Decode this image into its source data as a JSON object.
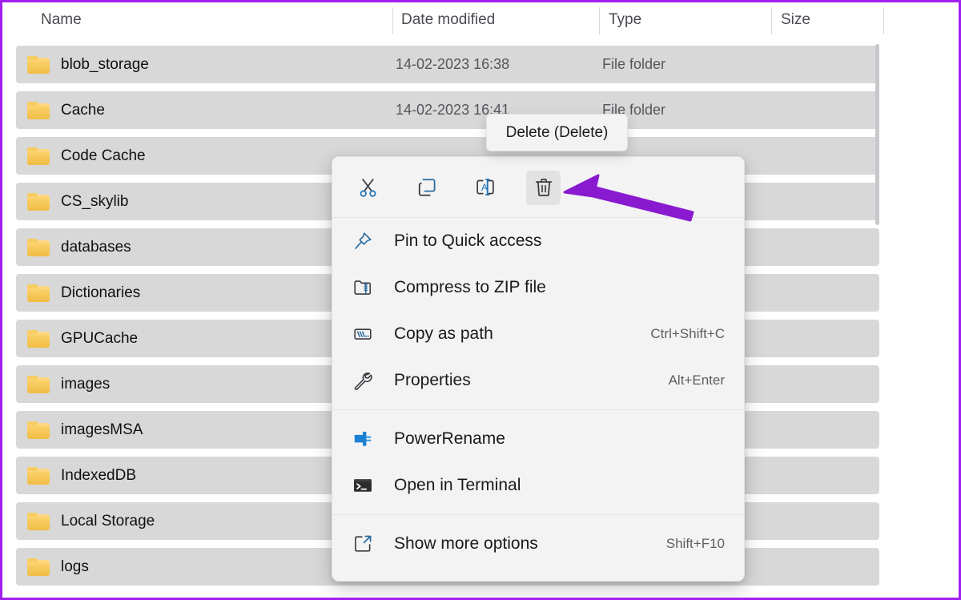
{
  "window": {
    "accent_border_color": "#a020f0",
    "row_bg_color": "#d8d8d8",
    "menu_bg_color": "#f3f3f3",
    "annotation_arrow_color": "#8a1ad0"
  },
  "columns": [
    {
      "label": "Name",
      "key": "name"
    },
    {
      "label": "Date modified",
      "key": "date"
    },
    {
      "label": "Type",
      "key": "type"
    },
    {
      "label": "Size",
      "key": "size"
    }
  ],
  "files": [
    {
      "name": "blob_storage",
      "date": "14-02-2023 16:38",
      "type": "File folder",
      "size": ""
    },
    {
      "name": "Cache",
      "date": "14-02-2023 16:41",
      "type": "File folder",
      "size": ""
    },
    {
      "name": "Code Cache",
      "date": "",
      "type": "",
      "size": ""
    },
    {
      "name": "CS_skylib",
      "date": "",
      "type": "",
      "size": ""
    },
    {
      "name": "databases",
      "date": "",
      "type": "",
      "size": ""
    },
    {
      "name": "Dictionaries",
      "date": "",
      "type": "",
      "size": ""
    },
    {
      "name": "GPUCache",
      "date": "",
      "type": "",
      "size": ""
    },
    {
      "name": "images",
      "date": "",
      "type": "",
      "size": ""
    },
    {
      "name": "imagesMSA",
      "date": "",
      "type": "",
      "size": ""
    },
    {
      "name": "IndexedDB",
      "date": "",
      "type": "",
      "size": ""
    },
    {
      "name": "Local Storage",
      "date": "",
      "type": "",
      "size": ""
    },
    {
      "name": "logs",
      "date": "",
      "type": "",
      "size": ""
    }
  ],
  "tooltip": {
    "text": "Delete (Delete)"
  },
  "context_menu": {
    "toolbar": [
      {
        "icon": "cut-icon",
        "label": "Cut",
        "hovered": false
      },
      {
        "icon": "copy-icon",
        "label": "Copy",
        "hovered": false
      },
      {
        "icon": "rename-icon",
        "label": "Rename",
        "hovered": false
      },
      {
        "icon": "delete-icon",
        "label": "Delete",
        "hovered": true
      }
    ],
    "groups": [
      {
        "items": [
          {
            "icon": "pin-icon",
            "label": "Pin to Quick access",
            "accel": ""
          },
          {
            "icon": "zip-icon",
            "label": "Compress to ZIP file",
            "accel": ""
          },
          {
            "icon": "path-icon",
            "label": "Copy as path",
            "accel": "Ctrl+Shift+C"
          },
          {
            "icon": "wrench-icon",
            "label": "Properties",
            "accel": "Alt+Enter"
          }
        ]
      },
      {
        "items": [
          {
            "icon": "powerrename-icon",
            "label": "PowerRename",
            "accel": ""
          },
          {
            "icon": "terminal-icon",
            "label": "Open in Terminal",
            "accel": ""
          }
        ]
      },
      {
        "items": [
          {
            "icon": "show-more-icon",
            "label": "Show more options",
            "accel": "Shift+F10"
          }
        ]
      }
    ]
  }
}
